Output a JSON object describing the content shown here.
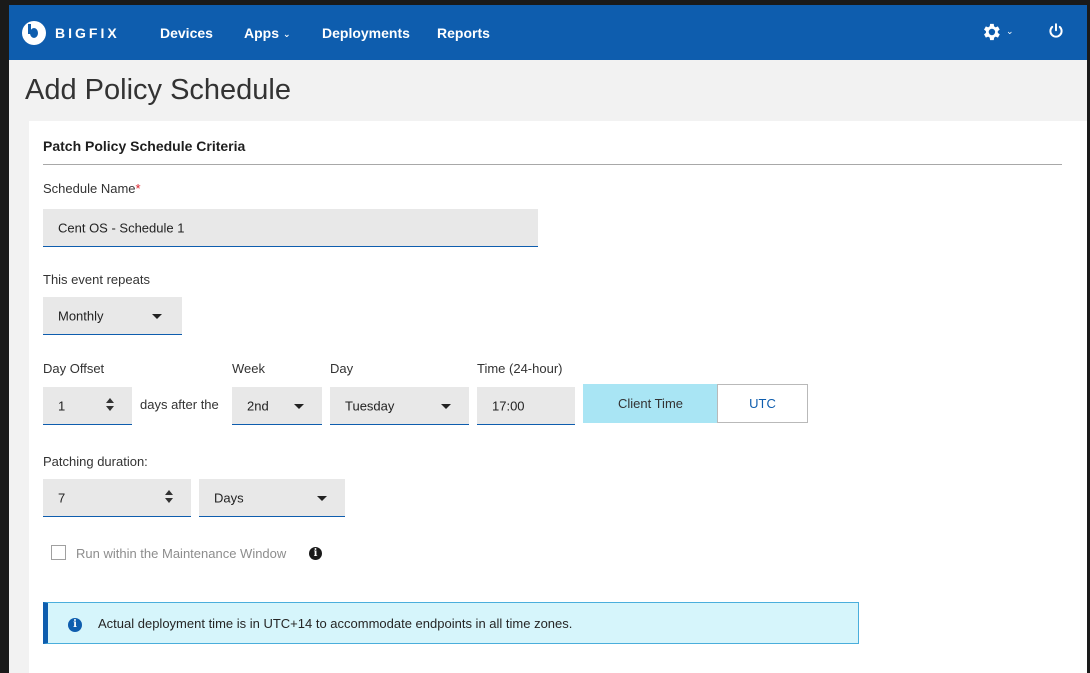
{
  "brand": {
    "name": "BIGFIX"
  },
  "nav": {
    "devices": "Devices",
    "apps": "Apps",
    "deployments": "Deployments",
    "reports": "Reports"
  },
  "page": {
    "title": "Add Policy Schedule"
  },
  "form": {
    "section_title": "Patch Policy Schedule Criteria",
    "schedule_name": {
      "label": "Schedule Name",
      "required_mark": "*",
      "value": "Cent OS - Schedule 1"
    },
    "repeats": {
      "label": "This event repeats",
      "value": "Monthly"
    },
    "day_offset": {
      "label": "Day Offset",
      "value": "1",
      "suffix": "days after the"
    },
    "week": {
      "label": "Week",
      "value": "2nd"
    },
    "day": {
      "label": "Day",
      "value": "Tuesday"
    },
    "time": {
      "label": "Time (24-hour)",
      "value": "17:00"
    },
    "time_mode": {
      "client": "Client Time",
      "utc": "UTC",
      "selected": "Client Time"
    },
    "duration": {
      "label": "Patching duration:",
      "value": "7",
      "unit": "Days"
    },
    "maintenance": {
      "label": "Run within the Maintenance Window",
      "checked": false
    },
    "notice": "Actual deployment time is in UTC+14 to accommodate endpoints in all time zones."
  },
  "colors": {
    "header": "#0e5dae",
    "selected_toggle": "#a9e5f4",
    "banner_bg": "#d6f5fb"
  }
}
